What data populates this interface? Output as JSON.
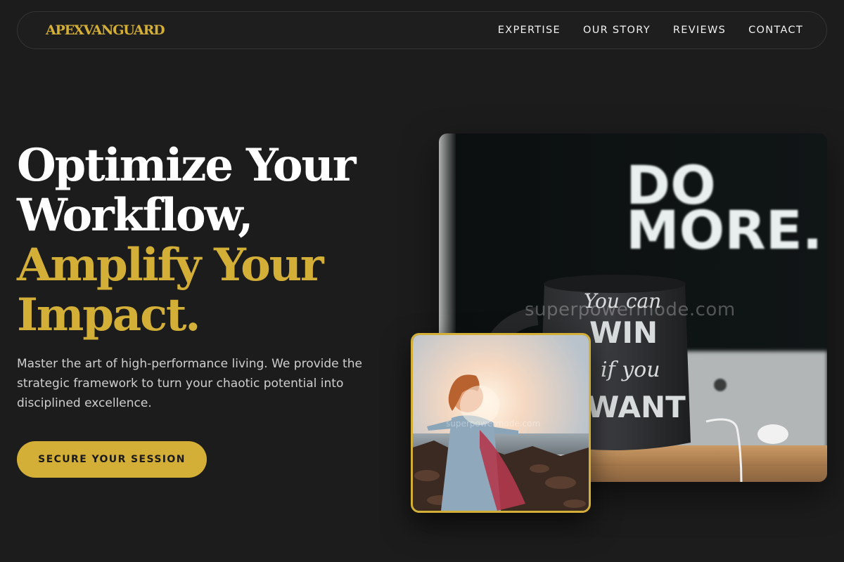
{
  "nav": {
    "logo": "APEXVANGUARD",
    "links": [
      "EXPERTISE",
      "OUR STORY",
      "REVIEWS",
      "CONTACT"
    ]
  },
  "hero": {
    "headline_white": [
      "Optimize Your",
      "Workflow,"
    ],
    "headline_gold": [
      "Amplify Your",
      "Impact."
    ],
    "subtext": "Master the art of high-performance living. We provide the strategic framework to turn your chaotic potential into disciplined excellence.",
    "cta_label": "SECURE YOUR SESSION"
  },
  "images": {
    "main": {
      "sign_text": [
        "DO",
        "MORE."
      ],
      "mug_text": [
        "You can",
        "WIN",
        "if you",
        "WANT"
      ],
      "watermark": "superpowermode.com"
    },
    "secondary": {
      "watermark": "superpowermode.com"
    }
  },
  "colors": {
    "background": "#1c1c1c",
    "accent": "#d4af37",
    "text": "#ffffff",
    "muted": "#cfcfcf"
  }
}
